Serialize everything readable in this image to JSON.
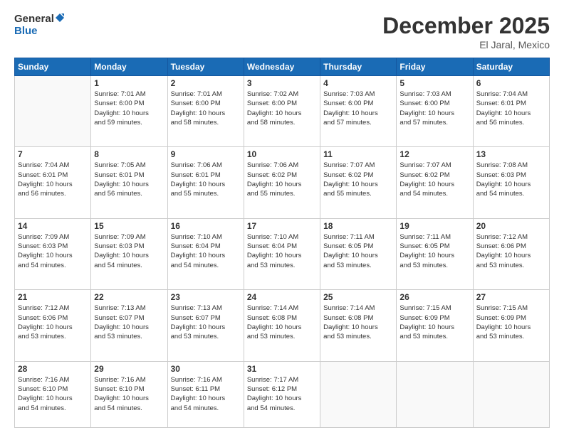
{
  "header": {
    "logo_general": "General",
    "logo_blue": "Blue",
    "title": "December 2025",
    "location": "El Jaral, Mexico"
  },
  "days_of_week": [
    "Sunday",
    "Monday",
    "Tuesday",
    "Wednesday",
    "Thursday",
    "Friday",
    "Saturday"
  ],
  "weeks": [
    [
      {
        "day": "",
        "info": ""
      },
      {
        "day": "1",
        "info": "Sunrise: 7:01 AM\nSunset: 6:00 PM\nDaylight: 10 hours\nand 59 minutes."
      },
      {
        "day": "2",
        "info": "Sunrise: 7:01 AM\nSunset: 6:00 PM\nDaylight: 10 hours\nand 58 minutes."
      },
      {
        "day": "3",
        "info": "Sunrise: 7:02 AM\nSunset: 6:00 PM\nDaylight: 10 hours\nand 58 minutes."
      },
      {
        "day": "4",
        "info": "Sunrise: 7:03 AM\nSunset: 6:00 PM\nDaylight: 10 hours\nand 57 minutes."
      },
      {
        "day": "5",
        "info": "Sunrise: 7:03 AM\nSunset: 6:00 PM\nDaylight: 10 hours\nand 57 minutes."
      },
      {
        "day": "6",
        "info": "Sunrise: 7:04 AM\nSunset: 6:01 PM\nDaylight: 10 hours\nand 56 minutes."
      }
    ],
    [
      {
        "day": "7",
        "info": "Sunrise: 7:04 AM\nSunset: 6:01 PM\nDaylight: 10 hours\nand 56 minutes."
      },
      {
        "day": "8",
        "info": "Sunrise: 7:05 AM\nSunset: 6:01 PM\nDaylight: 10 hours\nand 56 minutes."
      },
      {
        "day": "9",
        "info": "Sunrise: 7:06 AM\nSunset: 6:01 PM\nDaylight: 10 hours\nand 55 minutes."
      },
      {
        "day": "10",
        "info": "Sunrise: 7:06 AM\nSunset: 6:02 PM\nDaylight: 10 hours\nand 55 minutes."
      },
      {
        "day": "11",
        "info": "Sunrise: 7:07 AM\nSunset: 6:02 PM\nDaylight: 10 hours\nand 55 minutes."
      },
      {
        "day": "12",
        "info": "Sunrise: 7:07 AM\nSunset: 6:02 PM\nDaylight: 10 hours\nand 54 minutes."
      },
      {
        "day": "13",
        "info": "Sunrise: 7:08 AM\nSunset: 6:03 PM\nDaylight: 10 hours\nand 54 minutes."
      }
    ],
    [
      {
        "day": "14",
        "info": "Sunrise: 7:09 AM\nSunset: 6:03 PM\nDaylight: 10 hours\nand 54 minutes."
      },
      {
        "day": "15",
        "info": "Sunrise: 7:09 AM\nSunset: 6:03 PM\nDaylight: 10 hours\nand 54 minutes."
      },
      {
        "day": "16",
        "info": "Sunrise: 7:10 AM\nSunset: 6:04 PM\nDaylight: 10 hours\nand 54 minutes."
      },
      {
        "day": "17",
        "info": "Sunrise: 7:10 AM\nSunset: 6:04 PM\nDaylight: 10 hours\nand 53 minutes."
      },
      {
        "day": "18",
        "info": "Sunrise: 7:11 AM\nSunset: 6:05 PM\nDaylight: 10 hours\nand 53 minutes."
      },
      {
        "day": "19",
        "info": "Sunrise: 7:11 AM\nSunset: 6:05 PM\nDaylight: 10 hours\nand 53 minutes."
      },
      {
        "day": "20",
        "info": "Sunrise: 7:12 AM\nSunset: 6:06 PM\nDaylight: 10 hours\nand 53 minutes."
      }
    ],
    [
      {
        "day": "21",
        "info": "Sunrise: 7:12 AM\nSunset: 6:06 PM\nDaylight: 10 hours\nand 53 minutes."
      },
      {
        "day": "22",
        "info": "Sunrise: 7:13 AM\nSunset: 6:07 PM\nDaylight: 10 hours\nand 53 minutes."
      },
      {
        "day": "23",
        "info": "Sunrise: 7:13 AM\nSunset: 6:07 PM\nDaylight: 10 hours\nand 53 minutes."
      },
      {
        "day": "24",
        "info": "Sunrise: 7:14 AM\nSunset: 6:08 PM\nDaylight: 10 hours\nand 53 minutes."
      },
      {
        "day": "25",
        "info": "Sunrise: 7:14 AM\nSunset: 6:08 PM\nDaylight: 10 hours\nand 53 minutes."
      },
      {
        "day": "26",
        "info": "Sunrise: 7:15 AM\nSunset: 6:09 PM\nDaylight: 10 hours\nand 53 minutes."
      },
      {
        "day": "27",
        "info": "Sunrise: 7:15 AM\nSunset: 6:09 PM\nDaylight: 10 hours\nand 53 minutes."
      }
    ],
    [
      {
        "day": "28",
        "info": "Sunrise: 7:16 AM\nSunset: 6:10 PM\nDaylight: 10 hours\nand 54 minutes."
      },
      {
        "day": "29",
        "info": "Sunrise: 7:16 AM\nSunset: 6:10 PM\nDaylight: 10 hours\nand 54 minutes."
      },
      {
        "day": "30",
        "info": "Sunrise: 7:16 AM\nSunset: 6:11 PM\nDaylight: 10 hours\nand 54 minutes."
      },
      {
        "day": "31",
        "info": "Sunrise: 7:17 AM\nSunset: 6:12 PM\nDaylight: 10 hours\nand 54 minutes."
      },
      {
        "day": "",
        "info": ""
      },
      {
        "day": "",
        "info": ""
      },
      {
        "day": "",
        "info": ""
      }
    ]
  ]
}
